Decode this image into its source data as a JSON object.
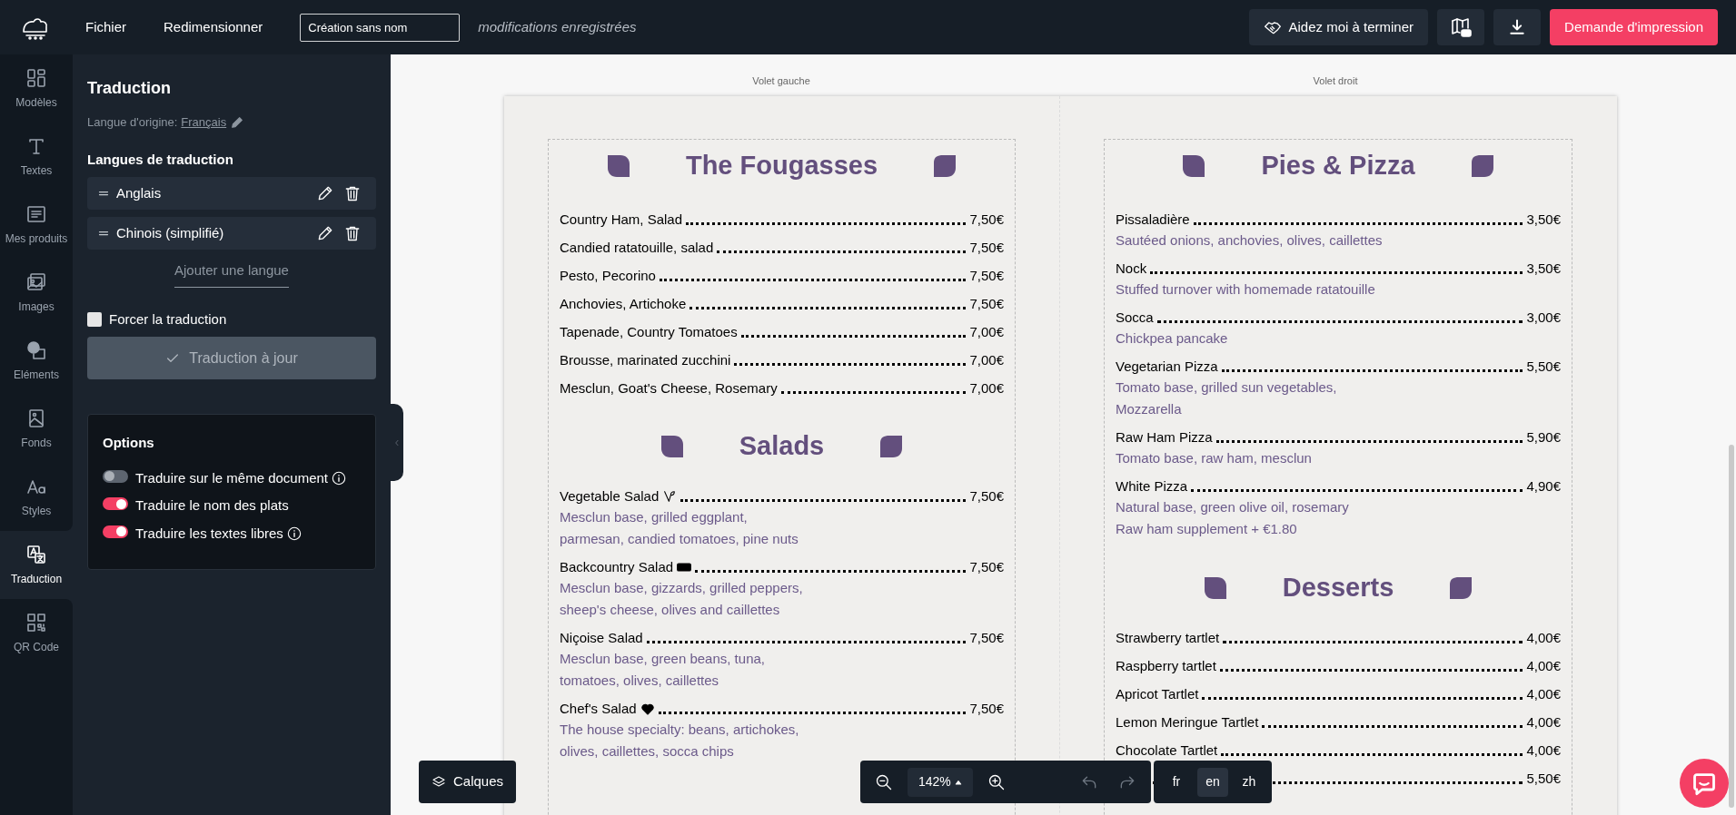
{
  "topbar": {
    "menu": [
      "Fichier",
      "Redimensionner"
    ],
    "doc_name": "Création sans nom",
    "save_status": "modifications enregistrées",
    "help_button": "Aidez moi à terminer",
    "print_button": "Demande d'impression"
  },
  "rail": [
    {
      "label": "Modèles",
      "kind": "grid",
      "selected": false
    },
    {
      "label": "Textes",
      "kind": "text",
      "selected": false
    },
    {
      "label": "Mes produits",
      "kind": "list",
      "selected": false
    },
    {
      "label": "Images",
      "kind": "images",
      "selected": false
    },
    {
      "label": "Eléments",
      "kind": "shapes",
      "selected": false
    },
    {
      "label": "Fonds",
      "kind": "image",
      "selected": false
    },
    {
      "label": "Styles",
      "kind": "styles",
      "selected": false
    },
    {
      "label": "Traduction",
      "kind": "translate",
      "selected": true
    },
    {
      "label": "QR Code",
      "kind": "qr",
      "selected": false
    }
  ],
  "panel": {
    "title": "Traduction",
    "origin_label": "Langue d'origine:",
    "origin_language": "Français",
    "languages_heading": "Langues de traduction",
    "languages": [
      "Anglais",
      "Chinois (simplifié)"
    ],
    "add_language": "Ajouter une langue",
    "force_translation": {
      "label": "Forcer la traduction",
      "checked": false
    },
    "status_button": "Traduction à jour",
    "options": {
      "title": "Options",
      "toggles": [
        {
          "label": "Traduire sur le même document",
          "on": false,
          "info": true
        },
        {
          "label": "Traduire le nom des plats",
          "on": true,
          "info": false
        },
        {
          "label": "Traduire les textes libres",
          "on": true,
          "info": true
        }
      ]
    }
  },
  "canvas": {
    "pane_labels": [
      "Volet gauche",
      "Volet droit"
    ],
    "columns": [
      {
        "sections": [
          {
            "title": "The Fougasses",
            "items": [
              {
                "name": "Country Ham, Salad",
                "price": "7,50€"
              },
              {
                "name": "Candied ratatouille, salad",
                "price": "7,50€"
              },
              {
                "name": "Pesto, Pecorino",
                "price": "7,50€"
              },
              {
                "name": "Anchovies, Artichoke",
                "price": "7,50€"
              },
              {
                "name": "Tapenade, Country Tomatoes",
                "price": "7,00€"
              },
              {
                "name": "Brousse, marinated zucchini",
                "price": "7,00€"
              },
              {
                "name": "Mesclun, Goat's Cheese, Rosemary",
                "price": "7,00€"
              }
            ]
          },
          {
            "title": "Salads",
            "items": [
              {
                "name": "Vegetable Salad",
                "kind": "vegetarian",
                "price": "7,50€",
                "description": [
                  "Mesclun base, grilled eggplant,",
                  "parmesan, candied tomatoes, pine nuts"
                ]
              },
              {
                "name": "Backcountry Salad",
                "kind": "new",
                "price": "7,50€",
                "description": [
                  "Mesclun base, gizzards, grilled peppers,",
                  "sheep's cheese, olives and caillettes"
                ]
              },
              {
                "name": "Niçoise Salad",
                "price": "7,50€",
                "description": [
                  "Mesclun base, green beans, tuna,",
                  "tomatoes, olives, caillettes"
                ]
              },
              {
                "name": "Chef's Salad",
                "kind": "favorite",
                "price": "7,50€",
                "description": [
                  "The house specialty: beans, artichokes,",
                  "olives, caillettes, socca chips"
                ]
              }
            ]
          }
        ]
      },
      {
        "sections": [
          {
            "title": "Pies & Pizza",
            "items": [
              {
                "name": "Pissaladière",
                "price": "3,50€",
                "description": [
                  "Sautéed onions, anchovies, olives, caillettes"
                ]
              },
              {
                "name": "Nock",
                "price": "3,50€",
                "description": [
                  "Stuffed turnover with homemade ratatouille"
                ]
              },
              {
                "name": "Socca",
                "price": "3,00€",
                "description": [
                  "Chickpea pancake"
                ]
              },
              {
                "name": "Vegetarian Pizza",
                "price": "5,50€",
                "description": [
                  "Tomato base, grilled sun vegetables,",
                  "Mozzarella"
                ]
              },
              {
                "name": "Raw Ham Pizza",
                "price": "5,90€",
                "description": [
                  "Tomato base, raw ham, mesclun"
                ]
              },
              {
                "name": "White Pizza",
                "price": "4,90€",
                "description": [
                  "Natural base, green olive oil, rosemary",
                  "Raw ham supplement + €1.80"
                ]
              }
            ]
          },
          {
            "title": "Desserts",
            "items": [
              {
                "name": "Strawberry tartlet",
                "price": "4,00€"
              },
              {
                "name": "Raspberry tartlet",
                "price": "4,00€"
              },
              {
                "name": "Apricot Tartlet",
                "price": "4,00€"
              },
              {
                "name": "Lemon Meringue Tartlet",
                "price": "4,00€"
              },
              {
                "name": "Chocolate Tartlet",
                "price": "4,00€"
              },
              {
                "price": "5,50€"
              }
            ]
          }
        ]
      }
    ]
  },
  "bottom": {
    "layers_button": "Calques",
    "zoom": "142%",
    "languages": [
      {
        "label": "fr",
        "selected": false
      },
      {
        "label": "en",
        "selected": true
      },
      {
        "label": "zh",
        "selected": false
      }
    ]
  }
}
